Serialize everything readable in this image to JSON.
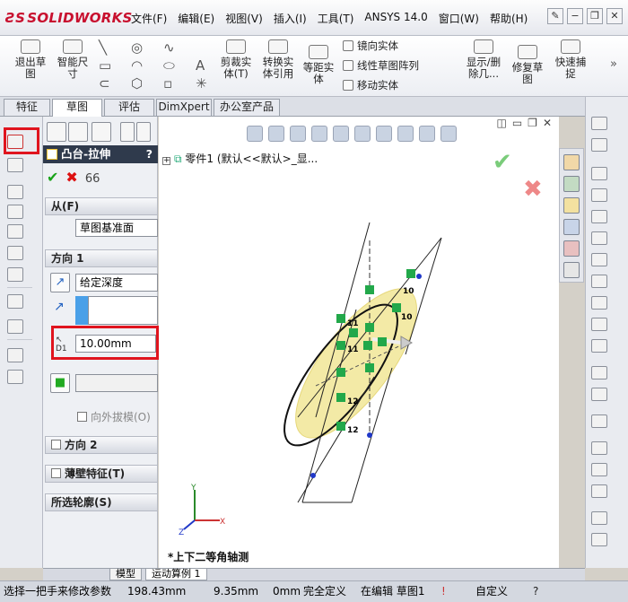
{
  "app": {
    "logo": "SOLIDWORKS"
  },
  "menu": [
    "文件(F)",
    "编辑(E)",
    "视图(V)",
    "插入(I)",
    "工具(T)",
    "ANSYS 14.0",
    "窗口(W)",
    "帮助(H)"
  ],
  "toolbar": {
    "exit_sketch": "退出草\n图",
    "smart_dim": "智能尺\n寸",
    "trim": "剪裁实\n体(T)",
    "convert": "转换实\n体引用",
    "offset": "等距实\n体",
    "mirror": "镜向实体",
    "linear_pattern": "线性草图阵列",
    "move": "移动实体",
    "show_delete": "显示/删\n除几...",
    "repair": "修复草\n图",
    "quick_snap": "快速捕\n捉"
  },
  "tabs": [
    "特征",
    "草图",
    "评估",
    "DimXpert",
    "办公室产品"
  ],
  "property_manager": {
    "title": "凸台-拉伸",
    "help": "?",
    "from_section": "从(F)",
    "from_value": "草图基准面",
    "dir1_section": "方向 1",
    "end_condition": "给定深度",
    "depth": "10.00mm",
    "draft_outward": "向外拔模(O)",
    "dir2_section": "方向 2",
    "thin_feature": "薄壁特征(T)",
    "selected_contours": "所选轮廓(S)"
  },
  "canvas": {
    "tree_part": "零件1",
    "tree_suffix": "(默认<<默认>_显...",
    "view_label": "*上下二等角轴测",
    "dim_labels": [
      "10",
      "10",
      "11",
      "11",
      "12",
      "12"
    ]
  },
  "bottom_tabs": [
    "模型",
    "运动算例 1"
  ],
  "status": {
    "hint": "选择一把手来修改参数",
    "x": "198.43mm",
    "y": "9.35mm",
    "z": "0mm",
    "state": "完全定义",
    "editing": "在编辑 草图1",
    "unit": "自定义"
  },
  "colors": {
    "accent": "#e0141e",
    "ok": "#1aa31a",
    "title_bg": "#2f3a4c"
  }
}
